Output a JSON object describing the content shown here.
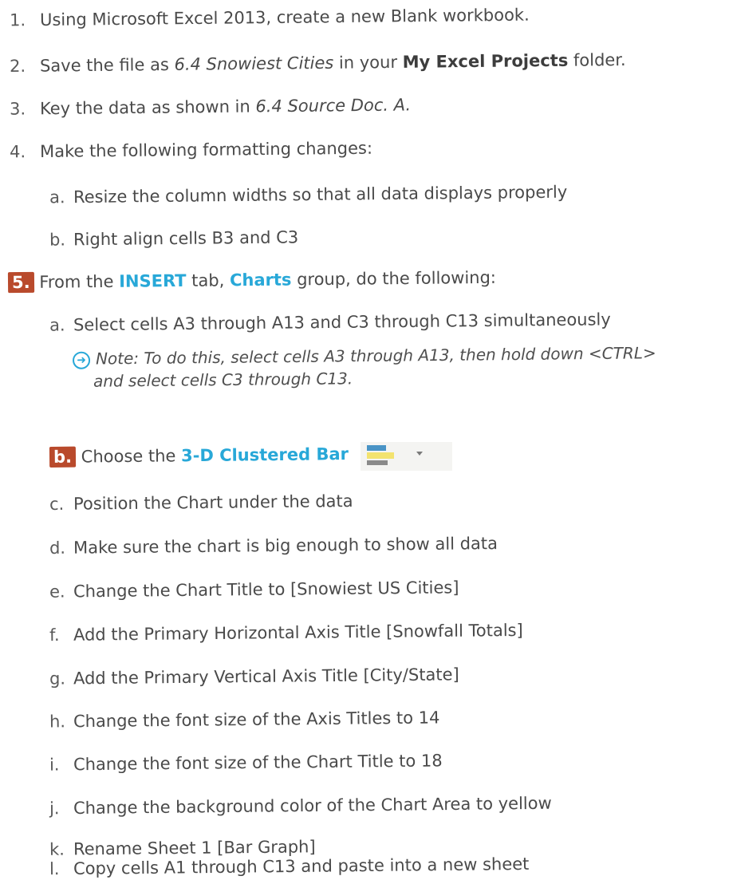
{
  "steps": [
    {
      "num": "1.",
      "text": "Using Microsoft Excel 2013, create a new Blank workbook."
    },
    {
      "num": "2.",
      "pre": "Save the file as ",
      "file": "6.4 Snowiest Cities",
      "mid": " in your ",
      "folder": "My Excel Projects",
      "post": " folder."
    },
    {
      "num": "3.",
      "pre": "Key the data as shown in ",
      "doc": "6.4 Source Doc. A."
    },
    {
      "num": "4.",
      "text": "Make the following formatting changes:"
    },
    {
      "num": "5.",
      "pre": "From the ",
      "tab": "INSERT",
      "mid": " tab, ",
      "group": "Charts",
      "post": " group, do the following:"
    }
  ],
  "step4_subs": [
    {
      "letter": "a.",
      "text": "Resize the column widths so that all data displays properly"
    },
    {
      "letter": "b.",
      "text": "Right align cells B3 and C3"
    }
  ],
  "step5_subs": [
    {
      "letter": "a.",
      "text": "Select cells A3 through A13 and C3 through C13 simultaneously"
    },
    {
      "letter": "b.",
      "pre": "Choose the ",
      "accent": "3-D Clustered Bar"
    },
    {
      "letter": "c.",
      "text": "Position the Chart under the data"
    },
    {
      "letter": "d.",
      "text": "Make sure the chart is big enough to show all data"
    },
    {
      "letter": "e.",
      "text": "Change the Chart Title to [Snowiest US Cities]"
    },
    {
      "letter": "f.",
      "text": "Add the Primary Horizontal Axis Title [Snowfall Totals]"
    },
    {
      "letter": "g.",
      "text": "Add the Primary Vertical Axis Title [City/State]"
    },
    {
      "letter": "h.",
      "text": "Change the font size of the Axis Titles to 14"
    },
    {
      "letter": "i.",
      "text": "Change the font size of the Chart Title to 18"
    },
    {
      "letter": "j.",
      "text": "Change the background color of the Chart Area to yellow"
    },
    {
      "letter": "k.",
      "text": "Rename Sheet 1 [Bar Graph]"
    },
    {
      "letter": "l.",
      "text": "Copy cells A1 through C13 and paste into a new sheet"
    }
  ],
  "note": {
    "icon": "arrow-circle-icon",
    "line1": "Note: To do this, select cells A3 through A13, then hold down <CTRL>",
    "line2": "and select cells C3 through C13."
  },
  "colors": {
    "accent": "#28a8d8",
    "badge": "#b94a2c",
    "text": "#4a4a4a"
  },
  "icons": {
    "bar_chart": "clustered-bar-chart-icon",
    "dropdown": "dropdown-arrow-icon"
  }
}
